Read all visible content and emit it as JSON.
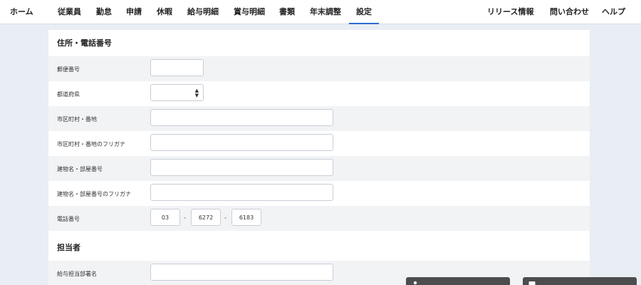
{
  "nav": {
    "items": [
      "ホーム",
      "従業員",
      "勤怠",
      "申請",
      "休暇",
      "給与明細",
      "賞与明細",
      "書類",
      "年末調整",
      "設定"
    ],
    "active": "設定",
    "right_items": [
      "リリース情報",
      "問い合わせ",
      "ヘルプ"
    ],
    "accent_color": "#2f6bd1"
  },
  "address": {
    "title": "住所・電話番号",
    "postal_label": "郵便番号",
    "postal_value": "",
    "prefecture_label": "都道府県",
    "prefecture_value": "",
    "city_label": "市区町村・番地",
    "city_value": "",
    "city_kana_label": "市区町村・番地のフリガナ",
    "city_kana_value": "",
    "building_label": "建物名・部屋番号",
    "building_value": "",
    "building_kana_label": "建物名・部屋番号のフリガナ",
    "building_kana_value": "",
    "phone_label": "電話番号",
    "phone_parts": [
      "03",
      "6272",
      "6183"
    ],
    "phone_separator": "-"
  },
  "contact": {
    "title": "担当者",
    "dept_label": "給与担当部署名",
    "dept_value": ""
  },
  "footer": {
    "left_button": "",
    "right_button": "",
    "left_icon": "person-icon",
    "right_icon": "chat-icon"
  }
}
